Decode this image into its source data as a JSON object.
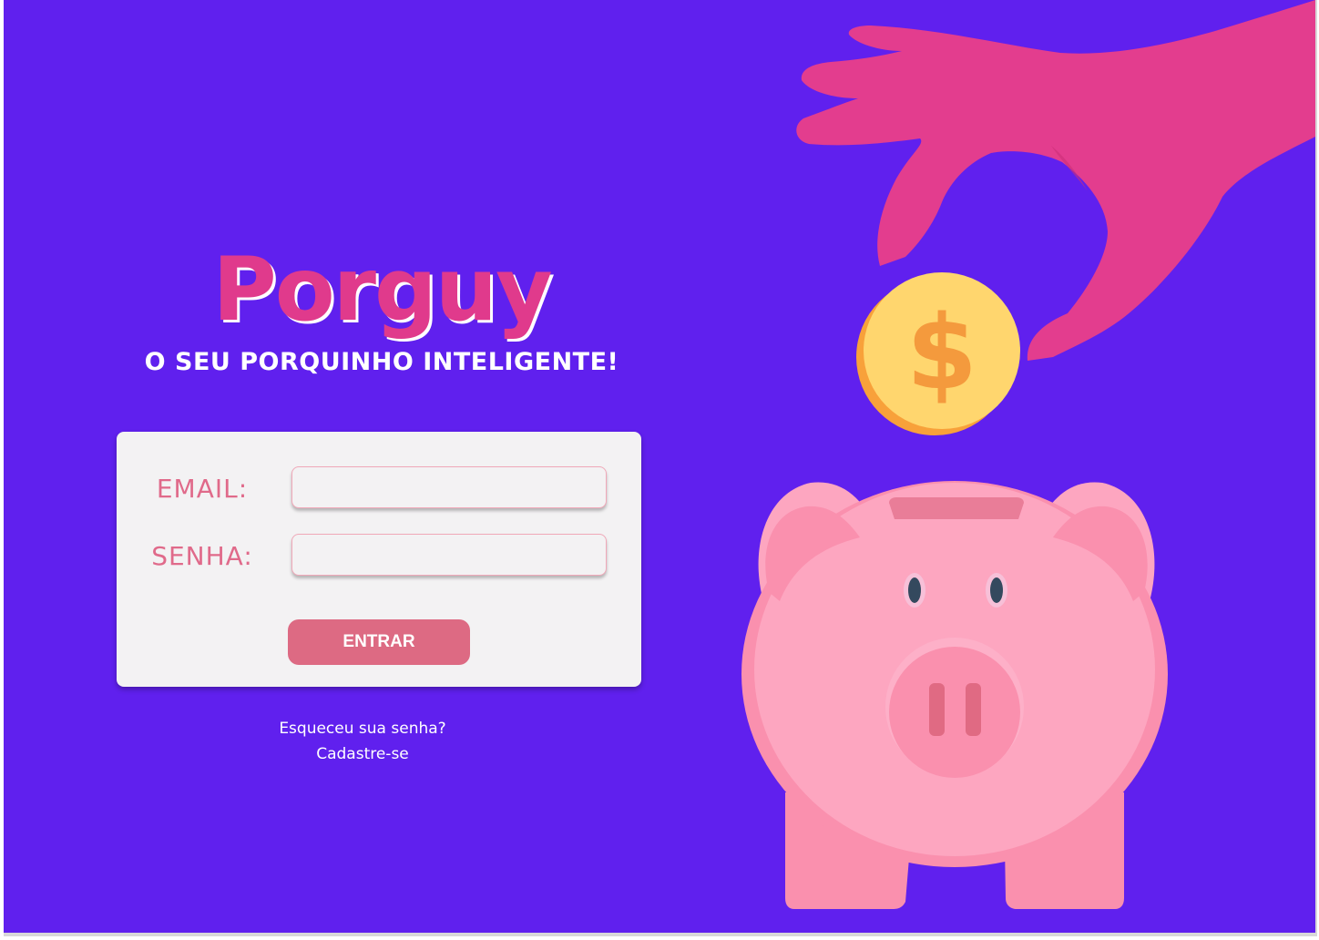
{
  "brand": {
    "name": "Porguy",
    "tagline": "O SEU PORQUINHO INTELIGENTE!"
  },
  "login_form": {
    "email_label": "EMAIL:",
    "email_value": "",
    "password_label": "SENHA:",
    "password_value": "",
    "submit_label": "ENTRAR"
  },
  "links": {
    "forgot_password": "Esqueceu sua senha?",
    "sign_up": "Cadastre-se"
  },
  "illustration": {
    "coin_symbol": "$",
    "icons": [
      "hand-icon",
      "coin-icon",
      "piggy-bank-icon"
    ]
  },
  "colors": {
    "background": "#6020EE",
    "brand_pink": "#E03A8C",
    "label_pink": "#E06A8A",
    "button": "#DD6A83",
    "card": "#F3F2F3",
    "pig": "#FDA6C0",
    "coin": "#FFD66E"
  }
}
